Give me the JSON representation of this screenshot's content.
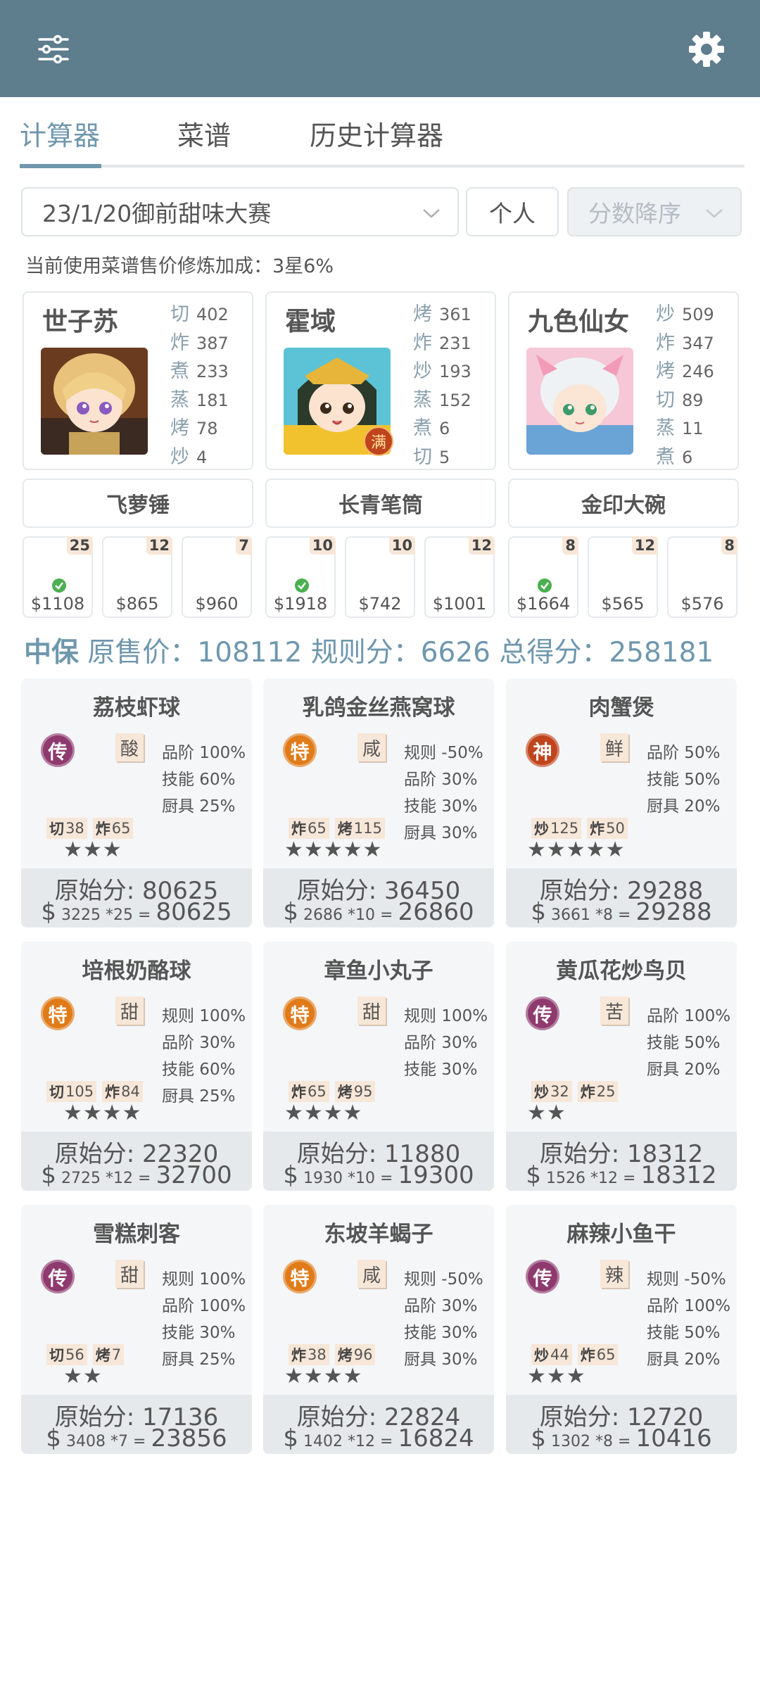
{
  "tabs": [
    "计算器",
    "菜谱",
    "历史计算器"
  ],
  "contest_select": "23/1/20御前甜味大赛",
  "mode_button": "个人",
  "sort_select": "分数降序",
  "bonus_text": "当前使用菜谱售价修炼加成：3星6%",
  "chefs": [
    {
      "name": "世子苏",
      "skills": [
        [
          "切",
          "402"
        ],
        [
          "炸",
          "387"
        ],
        [
          "煮",
          "233"
        ],
        [
          "蒸",
          "181"
        ],
        [
          "烤",
          "78"
        ],
        [
          "炒",
          "4"
        ]
      ],
      "full": ""
    },
    {
      "name": "霍域",
      "skills": [
        [
          "烤",
          "361"
        ],
        [
          "炸",
          "231"
        ],
        [
          "炒",
          "193"
        ],
        [
          "蒸",
          "152"
        ],
        [
          "煮",
          "6"
        ],
        [
          "切",
          "5"
        ]
      ],
      "full": "满"
    },
    {
      "name": "九色仙女",
      "skills": [
        [
          "炒",
          "509"
        ],
        [
          "炸",
          "347"
        ],
        [
          "烤",
          "246"
        ],
        [
          "切",
          "89"
        ],
        [
          "蒸",
          "11"
        ],
        [
          "煮",
          "6"
        ]
      ],
      "full": ""
    }
  ],
  "equipment": [
    "飞萝锤",
    "长青笔筒",
    "金印大碗"
  ],
  "price_boxes": [
    {
      "qty": "25",
      "price": "$1108",
      "checked": true
    },
    {
      "qty": "12",
      "price": "$865",
      "checked": false
    },
    {
      "qty": "7",
      "price": "$960",
      "checked": false
    },
    {
      "qty": "10",
      "price": "$1918",
      "checked": true
    },
    {
      "qty": "10",
      "price": "$742",
      "checked": false
    },
    {
      "qty": "12",
      "price": "$1001",
      "checked": false
    },
    {
      "qty": "8",
      "price": "$1664",
      "checked": true
    },
    {
      "qty": "12",
      "price": "$565",
      "checked": false
    },
    {
      "qty": "8",
      "price": "$576",
      "checked": false
    }
  ],
  "summary": {
    "rank": "中保",
    "text": "原售价：108112 规则分：6626 总得分：258181"
  },
  "recipes": [
    {
      "name": "荔枝虾球",
      "rarity": "传",
      "flavor": "酸",
      "addons": [
        "品阶 100%",
        "技能 60%",
        "厨具 25%"
      ],
      "reqs": [
        [
          "切",
          "38"
        ],
        [
          "炸",
          "65"
        ]
      ],
      "stars": "★★★",
      "raw": "原始分: 80625",
      "unit": "3225 *25 ",
      "eq": "=",
      "total": "80625"
    },
    {
      "name": "乳鸽金丝燕窝球",
      "rarity": "特",
      "flavor": "咸",
      "addons": [
        "规则 -50%",
        "品阶 30%",
        "技能 30%",
        "厨具 30%"
      ],
      "reqs": [
        [
          "炸",
          "65"
        ],
        [
          "烤",
          "115"
        ]
      ],
      "stars": "★★★★★",
      "raw": "原始分: 36450",
      "unit": "2686 *10 ",
      "eq": "=",
      "total": "26860"
    },
    {
      "name": "肉蟹煲",
      "rarity": "神",
      "flavor": "鲜",
      "addons": [
        "品阶 50%",
        "技能 50%",
        "厨具 20%"
      ],
      "reqs": [
        [
          "炒",
          "125"
        ],
        [
          "炸",
          "50"
        ]
      ],
      "stars": "★★★★★",
      "raw": "原始分: 29288",
      "unit": "3661 *8 ",
      "eq": "=",
      "total": "29288"
    },
    {
      "name": "培根奶酪球",
      "rarity": "特",
      "flavor": "甜",
      "addons": [
        "规则 100%",
        "品阶 30%",
        "技能 60%",
        "厨具 25%"
      ],
      "reqs": [
        [
          "切",
          "105"
        ],
        [
          "炸",
          "84"
        ]
      ],
      "stars": "★★★★",
      "raw": "原始分: 22320",
      "unit": "2725 *12 ",
      "eq": "=",
      "total": "32700"
    },
    {
      "name": "章鱼小丸子",
      "rarity": "特",
      "flavor": "甜",
      "addons": [
        "规则 100%",
        "品阶 30%",
        "技能 30%"
      ],
      "reqs": [
        [
          "炸",
          "65"
        ],
        [
          "烤",
          "95"
        ]
      ],
      "stars": "★★★★",
      "raw": "原始分: 11880",
      "unit": "1930 *10 ",
      "eq": "=",
      "total": "19300"
    },
    {
      "name": "黄瓜花炒鸟贝",
      "rarity": "传",
      "flavor": "苦",
      "addons": [
        "品阶 100%",
        "技能 50%",
        "厨具 20%"
      ],
      "reqs": [
        [
          "炒",
          "32"
        ],
        [
          "炸",
          "25"
        ]
      ],
      "stars": "★★",
      "raw": "原始分: 18312",
      "unit": "1526 *12 ",
      "eq": "=",
      "total": "18312"
    },
    {
      "name": "雪糕刺客",
      "rarity": "传",
      "flavor": "甜",
      "addons": [
        "规则 100%",
        "品阶 100%",
        "技能 30%",
        "厨具 25%"
      ],
      "reqs": [
        [
          "切",
          "56"
        ],
        [
          "烤",
          "7"
        ]
      ],
      "stars": "★★",
      "raw": "原始分: 17136",
      "unit": "3408 *7 ",
      "eq": "=",
      "total": "23856"
    },
    {
      "name": "东坡羊蝎子",
      "rarity": "特",
      "flavor": "咸",
      "addons": [
        "规则 -50%",
        "品阶 30%",
        "技能 30%",
        "厨具 30%"
      ],
      "reqs": [
        [
          "炸",
          "38"
        ],
        [
          "烤",
          "96"
        ]
      ],
      "stars": "★★★★",
      "raw": "原始分: 22824",
      "unit": "1402 *12 ",
      "eq": "=",
      "total": "16824"
    },
    {
      "name": "麻辣小鱼干",
      "rarity": "传",
      "flavor": "辣",
      "addons": [
        "规则 -50%",
        "品阶 100%",
        "技能 50%",
        "厨具 20%"
      ],
      "reqs": [
        [
          "炒",
          "44"
        ],
        [
          "炸",
          "65"
        ]
      ],
      "stars": "★★★",
      "raw": "原始分: 12720",
      "unit": "1302 *8 ",
      "eq": "=",
      "total": "10416"
    }
  ],
  "colors": {
    "topbar": "#5e7d8d",
    "accent": "#6f97ad",
    "rarity_chuan": "#8e3a6e",
    "rarity_te": "#e07b1a",
    "rarity_shen": "#c0451c"
  },
  "icons": {
    "menu": "sliders-icon",
    "settings": "gear-icon"
  }
}
